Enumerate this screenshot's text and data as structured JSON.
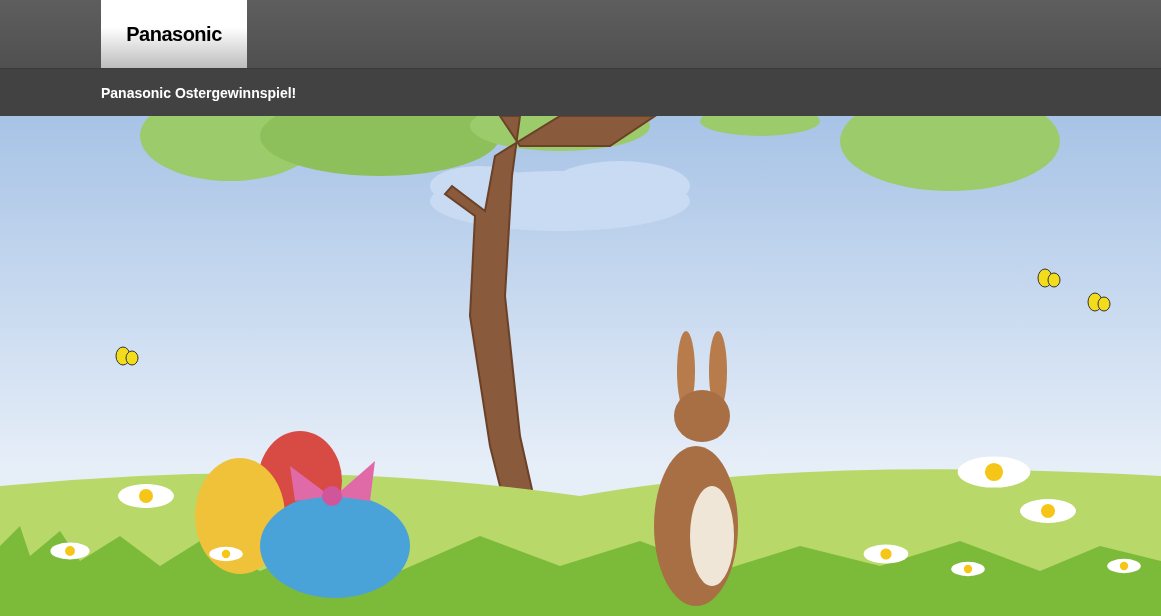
{
  "header": {
    "logo": "Panasonic"
  },
  "subheader": {
    "title": "Panasonic Ostergewinnspiel!"
  }
}
